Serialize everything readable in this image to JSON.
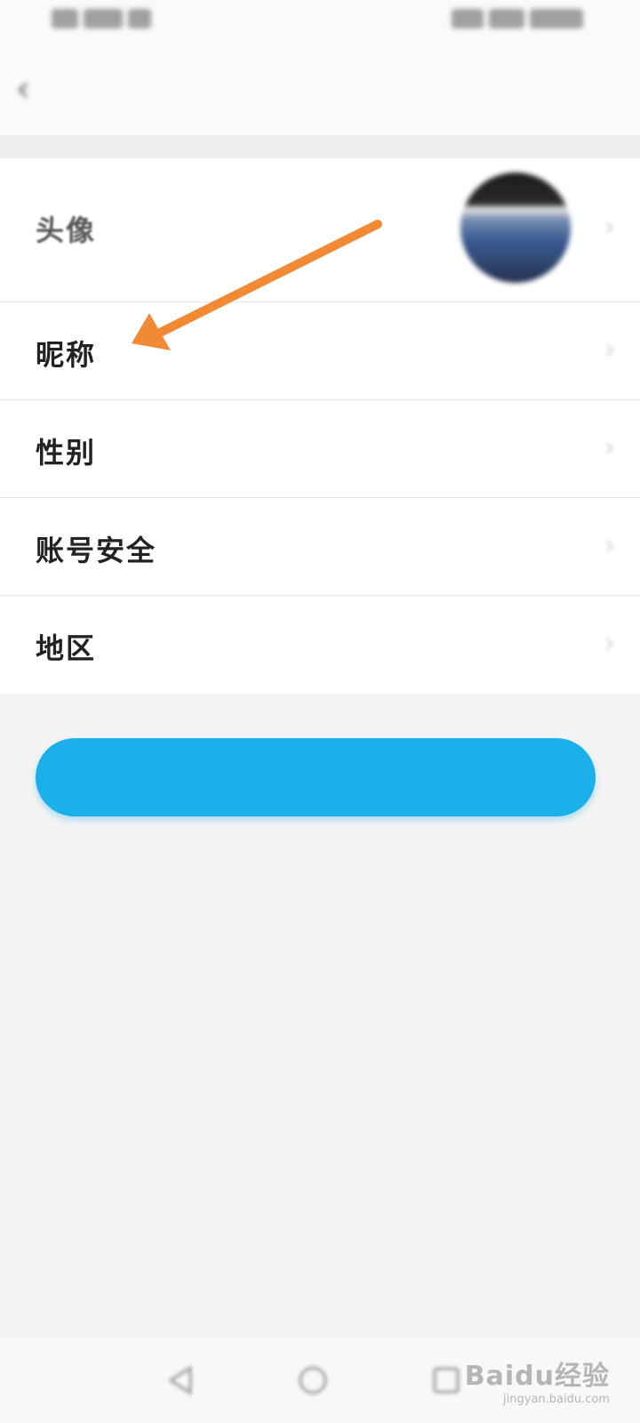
{
  "statusbar": {
    "left_text": "",
    "right_text": ""
  },
  "header": {
    "title": ""
  },
  "profile": {
    "rows": [
      {
        "label": "头像",
        "value": ""
      },
      {
        "label": "昵称",
        "value": ""
      },
      {
        "label": "性别",
        "value": ""
      },
      {
        "label": "账号安全",
        "value": ""
      },
      {
        "label": "地区",
        "value": ""
      }
    ]
  },
  "primary_button": {
    "label": ""
  },
  "annotation": {
    "color": "#f28a35",
    "target": "昵称"
  },
  "watermark": {
    "brand": "Baidu经验",
    "url": "jingyan.baidu.com"
  },
  "icons": {
    "back": "back-chevron-icon",
    "row_chevron": "chevron-right-icon",
    "nav_back": "nav-back-icon",
    "nav_home": "nav-home-icon",
    "nav_recent": "nav-recent-icon"
  },
  "colors": {
    "button": "#1bb0ea",
    "background": "#f4f4f4"
  }
}
